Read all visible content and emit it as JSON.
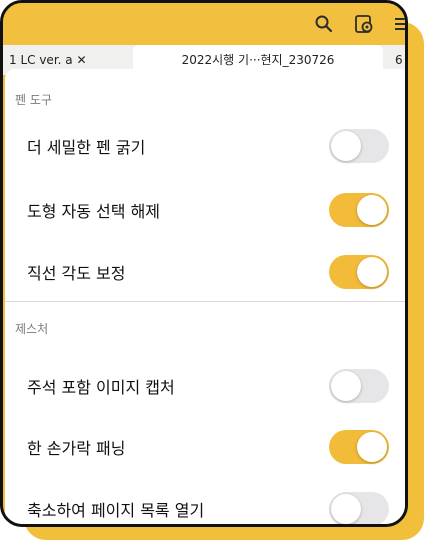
{
  "toolbar": {
    "icons": [
      "search-icon",
      "settings-gear-icon",
      "menu-icon"
    ]
  },
  "tabs": [
    {
      "label": "1 LC ver. a ✕",
      "active": false
    },
    {
      "label": "2022시행 기···현지_230726",
      "active": true
    },
    {
      "label": "6",
      "active": false
    }
  ],
  "sections": [
    {
      "header": "펜 도구",
      "items": [
        {
          "label": "더 세밀한 펜 굵기",
          "on": false
        },
        {
          "label": "도형 자동 선택 해제",
          "on": true
        },
        {
          "label": "직선 각도 보정",
          "on": true
        }
      ]
    },
    {
      "header": "제스처",
      "items": [
        {
          "label": "주석 포함 이미지 캡처",
          "on": false
        },
        {
          "label": "한 손가락 패닝",
          "on": true
        },
        {
          "label": "축소하여 페이지 목록 열기",
          "on": false
        }
      ]
    }
  ],
  "colors": {
    "accent": "#f2bb3a",
    "toggle_off": "#e6e6e8"
  }
}
